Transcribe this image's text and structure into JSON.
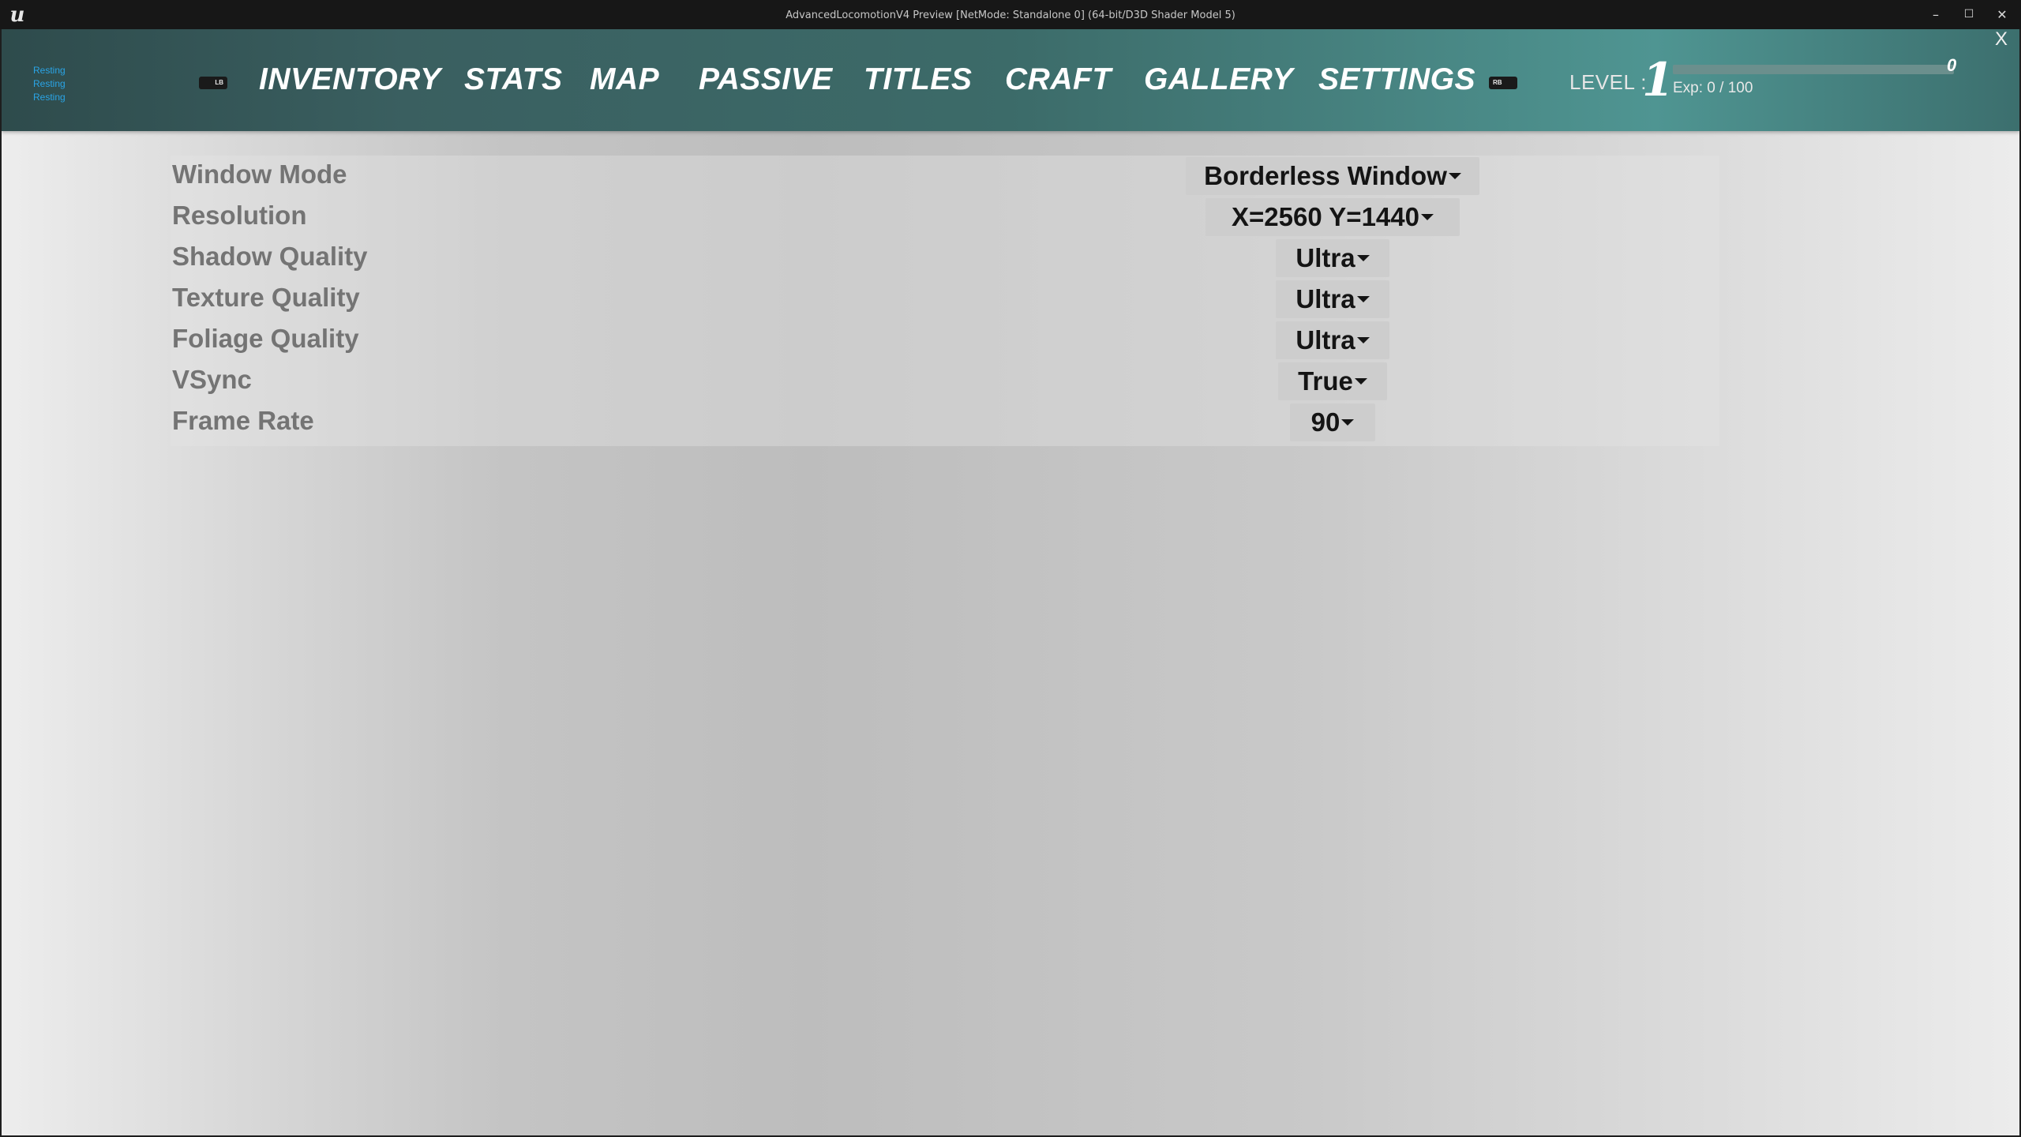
{
  "window": {
    "title": "AdvancedLocomotionV4 Preview [NetMode: Standalone 0]  (64-bit/D3D Shader Model 5)",
    "logo_icon": "unreal-logo-icon",
    "minimize_glyph": "–",
    "maximize_glyph": "☐",
    "close_glyph": "✕"
  },
  "debug": {
    "lines": [
      "Resting",
      "Resting",
      "Resting"
    ],
    "color": "#2aa4e6"
  },
  "header": {
    "left_bumper": "LB",
    "right_bumper": "RB",
    "tabs": [
      {
        "label": "INVENTORY"
      },
      {
        "label": "STATS"
      },
      {
        "label": "MAP"
      },
      {
        "label": "PASSIVE"
      },
      {
        "label": "TITLES"
      },
      {
        "label": "CRAFT"
      },
      {
        "label": "GALLERY"
      },
      {
        "label": "SETTINGS"
      }
    ],
    "active_tab": "SETTINGS",
    "level_label": "LEVEL :",
    "level_value": "1",
    "exp_progress": 0,
    "exp_number": "0",
    "exp_text": "Exp: 0 / 100",
    "close_label": "X"
  },
  "settings": {
    "rows": [
      {
        "label": "Window Mode",
        "value": "Borderless Window"
      },
      {
        "label": "Resolution",
        "value": "X=2560 Y=1440"
      },
      {
        "label": "Shadow Quality",
        "value": "Ultra"
      },
      {
        "label": "Texture Quality",
        "value": "Ultra"
      },
      {
        "label": "Foliage Quality",
        "value": "Ultra"
      },
      {
        "label": "VSync",
        "value": "True"
      },
      {
        "label": "Frame Rate",
        "value": "90"
      }
    ]
  },
  "colors": {
    "header_accent": "#4f9592",
    "label_text": "#747474",
    "dropdown_bg": "#cdcdcd"
  }
}
